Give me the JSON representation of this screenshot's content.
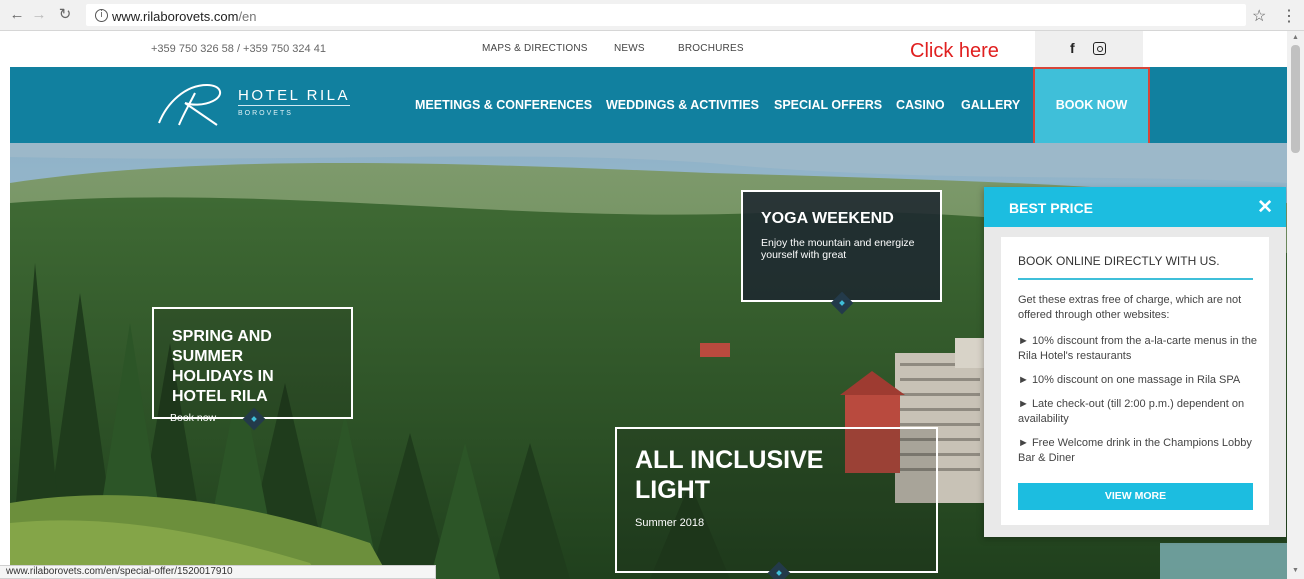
{
  "browser": {
    "url_host": "www.rilaborovets.com",
    "url_path": "/en",
    "status_url": "www.rilaborovets.com/en/special-offer/1520017910"
  },
  "topbar": {
    "phones": "+359 750 326 58 / +359 750 324 41",
    "links": [
      "MAPS & DIRECTIONS",
      "NEWS",
      "BROCHURES"
    ],
    "annotation": "Click here",
    "facebook_glyph": "f"
  },
  "logo": {
    "title": "HOTEL RILA",
    "subtitle": "BOROVETS"
  },
  "nav": {
    "items": [
      "MEETINGS & CONFERENCES",
      "WEDDINGS & ACTIVITIES",
      "SPECIAL OFFERS",
      "CASINO",
      "GALLERY"
    ],
    "book_now": "BOOK NOW"
  },
  "promos": {
    "yoga": {
      "title": "YOGA WEEKEND",
      "text": "Enjoy the mountain and energize yourself with great"
    },
    "spring": {
      "title": "SPRING AND SUMMER HOLIDAYS IN HOTEL RILA",
      "link": "Book now"
    },
    "allinc": {
      "title": "ALL INCLUSIVE LIGHT",
      "text": "Summer 2018"
    }
  },
  "best_price": {
    "header": "BEST PRICE",
    "close": "✕",
    "card_title": "BOOK ONLINE DIRECTLY WITH US.",
    "intro": "Get these extras free of charge, which are not offered through other websites:",
    "bullets": [
      "► 10% discount from the a-la-carte menus in the Rila Hotel's restaurants",
      "► 10% discount on one massage in Rila SPA",
      "► Late check-out (till 2:00 p.m.) dependent on availability",
      "► Free Welcome drink in the Champions Lobby Bar & Diner"
    ],
    "button": "VIEW MORE"
  },
  "colors": {
    "nav_bg": "#11809f",
    "book_now_bg": "#3fbfd9",
    "best_price_accent": "#1cbde0",
    "annotation_red": "#e02020"
  }
}
